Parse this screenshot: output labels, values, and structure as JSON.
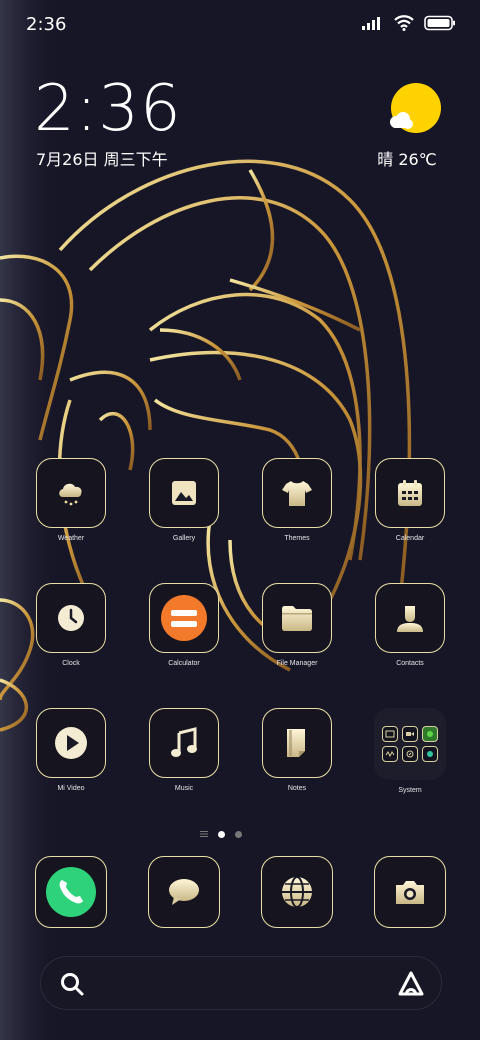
{
  "status_bar": {
    "time": "2:36"
  },
  "clock_widget": {
    "time": "2:36",
    "date": "7月26日 周三下午"
  },
  "weather_widget": {
    "temperature": "晴 26℃",
    "icon": "partly-sunny-icon"
  },
  "apps": {
    "row1": [
      {
        "label": "Weather",
        "icon": "weather-cloud-snow-icon"
      },
      {
        "label": "Gallery",
        "icon": "gallery-image-icon"
      },
      {
        "label": "Themes",
        "icon": "tshirt-icon"
      },
      {
        "label": "Calendar",
        "icon": "calendar-icon"
      }
    ],
    "row2": [
      {
        "label": "Clock",
        "icon": "clock-icon"
      },
      {
        "label": "Calculator",
        "icon": "calculator-icon"
      },
      {
        "label": "File Manager",
        "icon": "folder-icon"
      },
      {
        "label": "Contacts",
        "icon": "contact-person-icon"
      }
    ],
    "row3": [
      {
        "label": "Mi Video",
        "icon": "play-icon"
      },
      {
        "label": "Music",
        "icon": "music-note-icon"
      },
      {
        "label": "Notes",
        "icon": "note-icon"
      },
      {
        "label": "System",
        "icon": "folder-system-icon"
      }
    ]
  },
  "dock": [
    {
      "icon": "phone-icon"
    },
    {
      "icon": "message-bubble-icon"
    },
    {
      "icon": "browser-globe-icon"
    },
    {
      "icon": "camera-icon"
    }
  ],
  "colors": {
    "background": "#171627",
    "gold": "#e9dfa6",
    "calculator": "#f47a2b",
    "phone": "#2ed27a",
    "sun": "#ffd200"
  }
}
